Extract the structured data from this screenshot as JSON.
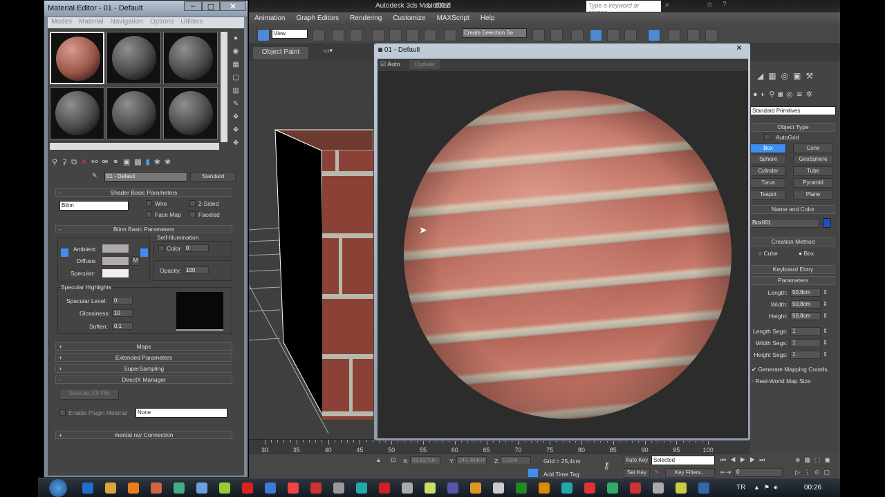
{
  "max_window": {
    "title": "Autodesk 3ds Max  2012",
    "file": "Untitled",
    "search_placeholder": "Type a keyword or phrase",
    "menu": [
      "Animation",
      "Graph Editors",
      "Rendering",
      "Customize",
      "MAXScript",
      "Help"
    ],
    "toolbar": {
      "ref_coord": "View",
      "selection_set": "Create Selection Se"
    },
    "ribbon_tab": "Object Paint"
  },
  "material_editor": {
    "title": "Material Editor - 01 - Default",
    "menu": [
      "Modes",
      "Material",
      "Navigation",
      "Options",
      "Utilities"
    ],
    "material_name": "01 - Default",
    "material_type": "Standard",
    "shader_rollout": "Shader Basic Parameters",
    "shader": "Blinn",
    "checkboxes": [
      {
        "label": "Wire",
        "checked": false
      },
      {
        "label": "2-Sided",
        "checked": false
      },
      {
        "label": "Face Map",
        "checked": false
      },
      {
        "label": "Faceted",
        "checked": false
      }
    ],
    "blinn_rollout": "Blinn Basic Parameters",
    "ambient_label": "Ambient:",
    "diffuse_label": "Diffuse:",
    "specular_label": "Specular:",
    "map_button": "M",
    "self_illum": {
      "title": "Self-Illumination",
      "color_label": "Color",
      "value": "0"
    },
    "opacity": {
      "label": "Opacity:",
      "value": "100"
    },
    "spec_highlights": {
      "title": "Specular Highlights",
      "level_label": "Specular Level:",
      "level": "0",
      "gloss_label": "Glossiness:",
      "gloss": "10",
      "soften_label": "Soften:",
      "soften": "0,1"
    },
    "rollouts": [
      "Maps",
      "Extended Parameters",
      "SuperSampling"
    ],
    "directx": {
      "title": "DirectX Manager",
      "save_button": "Save as .FX File",
      "enable_label": "Enable Plugin Material",
      "plugin": "None"
    },
    "mental_ray": "mental ray Connection"
  },
  "preview": {
    "title": "01 - Default",
    "auto_label": "Auto",
    "auto_checked": true,
    "update_button": "Update"
  },
  "command_panel": {
    "category": "Standard Primitives",
    "object_type_title": "Object Type",
    "autogrid": "AutoGrid",
    "buttons": [
      "Box",
      "Cone",
      "Sphere",
      "GeoSphere",
      "Cylinder",
      "Tube",
      "Torus",
      "Pyramid",
      "Teapot",
      "Plane"
    ],
    "active_button": "Box",
    "name_color_title": "Name and Color",
    "object_name": "Box001",
    "object_color": "#1f4fb8",
    "creation_method_title": "Creation Method",
    "creation_methods": [
      "Cube",
      "Box"
    ],
    "creation_selected": "Box",
    "keyboard_entry": "Keyboard Entry",
    "parameters_title": "Parameters",
    "params": [
      {
        "label": "Length:",
        "value": "50,8cm"
      },
      {
        "label": "Width:",
        "value": "50,8cm"
      },
      {
        "label": "Height:",
        "value": "50,8cm"
      },
      {
        "label": "Length Segs:",
        "value": "1"
      },
      {
        "label": "Width Segs:",
        "value": "1"
      },
      {
        "label": "Height Segs:",
        "value": "1"
      }
    ],
    "gen_mapping": "Generate Mapping Coords.",
    "gen_mapping_checked": true,
    "real_world": "Real-World Map Size",
    "real_world_checked": false
  },
  "timeline": {
    "ticks": [
      "30",
      "35",
      "40",
      "45",
      "50",
      "55",
      "60",
      "65",
      "70",
      "75",
      "80",
      "85",
      "90",
      "95",
      "100"
    ]
  },
  "status": {
    "x_label": "X:",
    "x": "59,627cm",
    "y_label": "Y:",
    "y": "143,464cm",
    "z_label": "Z:",
    "z": "0,0cm",
    "grid": "Grid = 25,4cm",
    "add_time_tag": "Add Time Tag",
    "auto_key": "Auto Key",
    "set_key": "Set Key",
    "key_mode": "Selected",
    "key_filters": "Key Filters...",
    "frame": "0"
  },
  "taskbar": {
    "lang": "TR",
    "clock": "00:26"
  }
}
